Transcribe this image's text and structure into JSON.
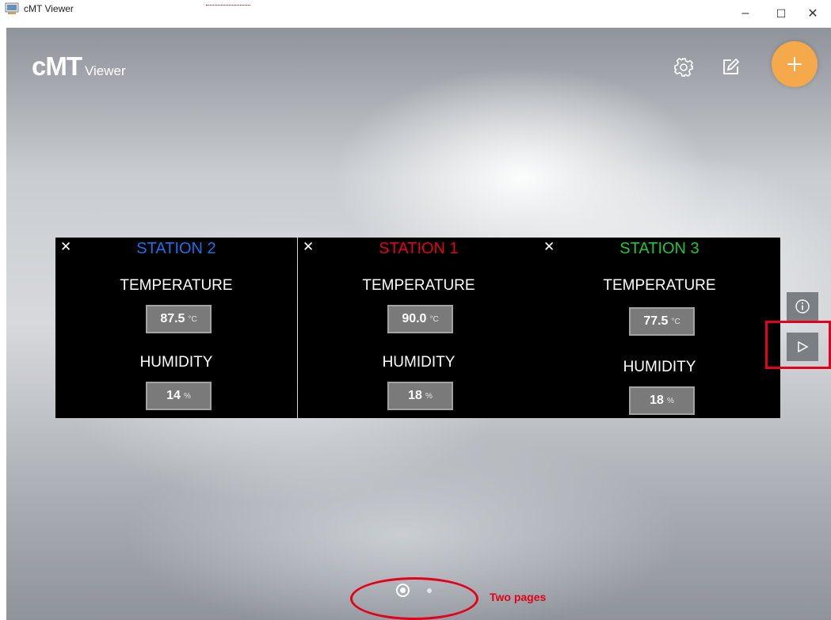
{
  "window": {
    "title": "cMT Viewer",
    "minimize": "–",
    "maximize": "☐",
    "close": "✕"
  },
  "logo": {
    "main": "cMT",
    "sub": "Viewer"
  },
  "toolbar": {
    "settings_icon": "gear-icon",
    "edit_icon": "edit-icon",
    "add_label": "+"
  },
  "colors": {
    "accent": "#f5a94a",
    "station1": "#e2001a",
    "station2": "#1f6fe6",
    "station3": "#22c43a",
    "annotation": "#e2001a"
  },
  "panels": [
    {
      "close": "✕",
      "station": "STATION 2",
      "temperature_label": "TEMPERATURE",
      "temperature": "87.5",
      "temperature_unit": "°C",
      "humidity_label": "HUMIDITY",
      "humidity": "14",
      "humidity_unit": "%"
    },
    {
      "close": "✕",
      "station": "STATION 1",
      "temperature_label": "TEMPERATURE",
      "temperature": "90.0",
      "temperature_unit": "°C",
      "humidity_label": "HUMIDITY",
      "humidity": "18",
      "humidity_unit": "%"
    },
    {
      "close": "✕",
      "station": "STATION 3",
      "temperature_label": "TEMPERATURE",
      "temperature": "77.5",
      "temperature_unit": "°C",
      "humidity_label": "HUMIDITY",
      "humidity": "18",
      "humidity_unit": "%"
    }
  ],
  "side": {
    "info_icon": "info-icon",
    "next_icon": "play-next-icon"
  },
  "pager": {
    "pages": 2,
    "current": 1
  },
  "annotation": {
    "text": "Two pages"
  }
}
